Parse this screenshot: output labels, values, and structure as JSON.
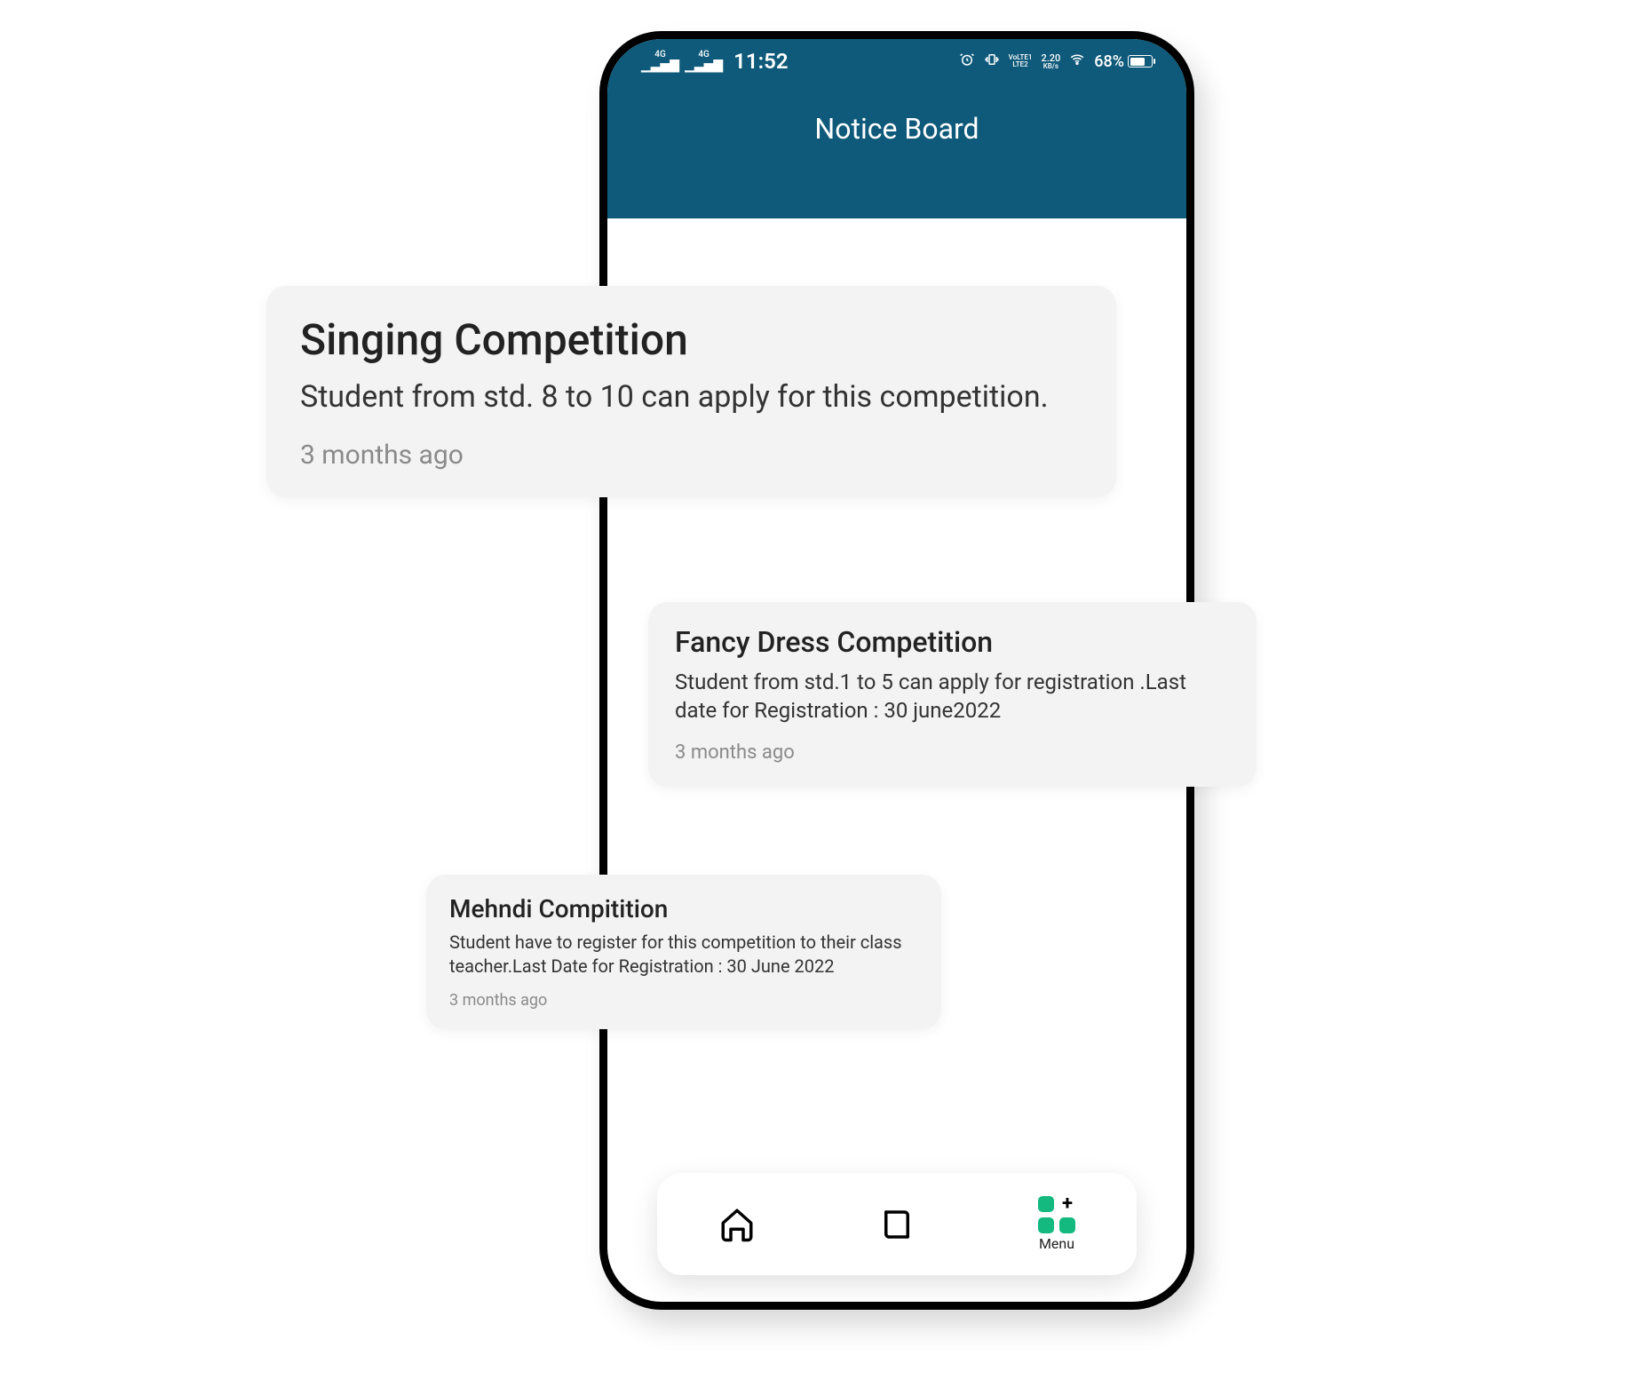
{
  "status": {
    "sig1_top": "4G",
    "sig2_top": "4G",
    "time": "11:52",
    "alarm": "⏰",
    "vibrate": "📳",
    "lte_top": "VoLTE1",
    "lte_bot": "LTE2",
    "speed_top": "2.20",
    "speed_bot": "KB/s",
    "wifi": "📶",
    "battery_pct": "68%"
  },
  "header": {
    "title": "Notice Board"
  },
  "notices": [
    {
      "title": "Singing Competition",
      "body": "Student from std. 8 to 10 can apply for this competition.",
      "time": "3 months ago"
    },
    {
      "title": "Fancy Dress Competition",
      "body": "Student from std.1 to 5 can apply for registration .Last date for Registration : 30 june2022",
      "time": "3 months ago"
    },
    {
      "title": "Mehndi Compitition",
      "body": "Student have to register for this competition to their class teacher.Last Date for Registration : 30 June 2022",
      "time": "3 months ago"
    }
  ],
  "nav": {
    "menu_label": "Menu"
  }
}
